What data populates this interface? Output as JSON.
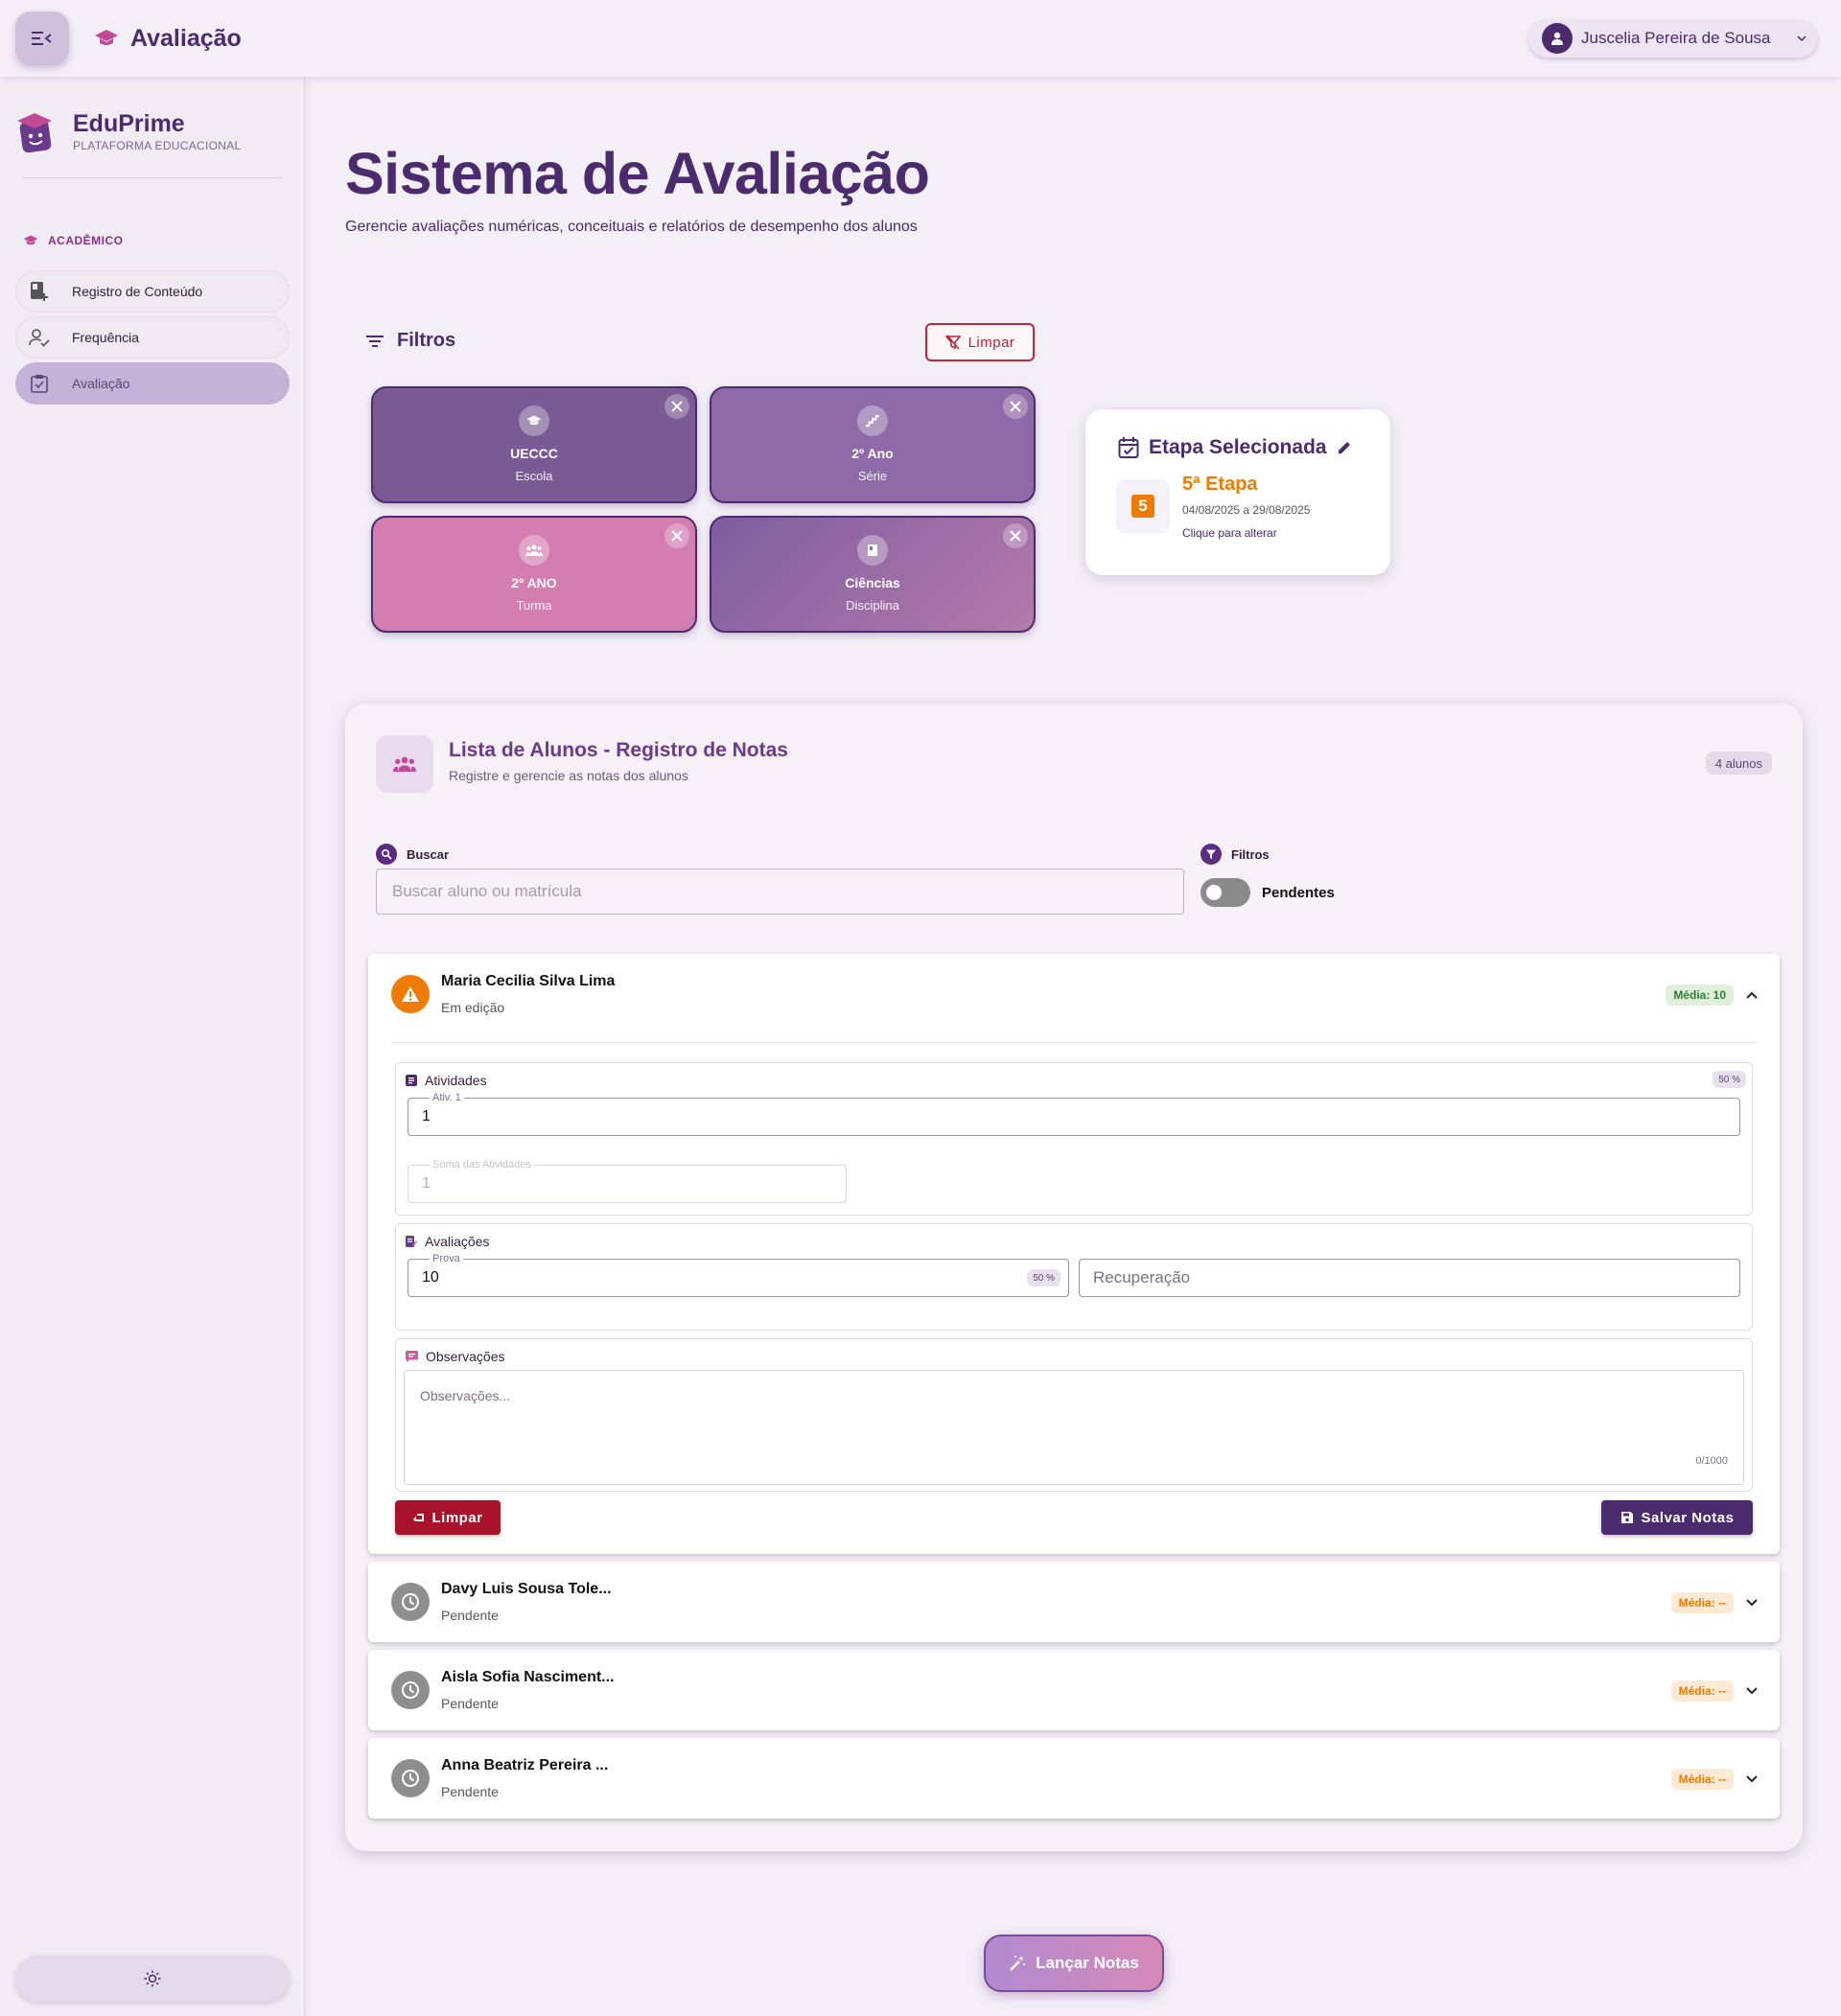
{
  "topbar": {
    "page_title": "Avaliação",
    "user_name": "Juscelia Pereira de Sousa"
  },
  "sidebar": {
    "brand_name": "EduPrime",
    "brand_tagline": "PLATAFORMA EDUCACIONAL",
    "section": "ACADÊMICO",
    "items": [
      {
        "label": "Registro de Conteúdo",
        "icon": "book-plus-icon",
        "active": false
      },
      {
        "label": "Frequência",
        "icon": "user-check-icon",
        "active": false
      },
      {
        "label": "Avaliação",
        "icon": "clipboard-check-icon",
        "active": true
      }
    ]
  },
  "hero": {
    "title": "Sistema de Avaliação",
    "subtitle": "Gerencie avaliações numéricas, conceituais e relatórios de desempenho dos alunos"
  },
  "filters": {
    "heading": "Filtros",
    "clear_label": "Limpar",
    "cards": [
      {
        "value": "UECCC",
        "label": "Escola",
        "icon": "graduation-cap-icon",
        "color": "#7a5a95"
      },
      {
        "value": "2º Ano",
        "label": "Série",
        "icon": "stairs-icon",
        "color": "#8f6aa8"
      },
      {
        "value": "2º ANO",
        "label": "Turma",
        "icon": "group-icon",
        "color": "#d47db1"
      },
      {
        "value": "Ciências",
        "label": "Disciplina",
        "icon": "book-icon",
        "color": "#9a6aa5"
      }
    ]
  },
  "stage": {
    "title": "Etapa Selecionada",
    "number": "5",
    "name": "5ª Etapa",
    "dates": "04/08/2025 a 29/08/2025",
    "change_label": "Clique para alterar"
  },
  "students_panel": {
    "title": "Lista de Alunos - Registro de Notas",
    "subtitle": "Registre e gerencie as notas dos alunos",
    "count": "4 alunos",
    "search_label": "Buscar",
    "search_placeholder": "Buscar aluno ou matrícula",
    "filters_label": "Filtros",
    "pending_toggle_label": "Pendentes"
  },
  "students": [
    {
      "name": "Maria Cecilia Silva Lima",
      "status": "Em edição",
      "average": "Média: 10",
      "expanded": true
    },
    {
      "name": "Davy Luis Sousa Tole...",
      "status": "Pendente",
      "average": "Média: --",
      "expanded": false
    },
    {
      "name": "Aisla Sofia Nasciment...",
      "status": "Pendente",
      "average": "Média: --",
      "expanded": false
    },
    {
      "name": "Anna Beatriz Pereira ...",
      "status": "Pendente",
      "average": "Média: --",
      "expanded": false
    }
  ],
  "grade_form": {
    "activities_title": "Atividades",
    "activities_weight": "50 %",
    "activity_label": "Ativ. 1",
    "activity_value": "1",
    "sum_label": "Soma das Atividades",
    "sum_value": "1",
    "assessments_title": "Avaliações",
    "exam_label": "Prova",
    "exam_value": "10",
    "exam_weight": "50 %",
    "recovery_placeholder": "Recuperação",
    "observations_title": "Observações",
    "observations_placeholder": "Observações...",
    "observations_counter": "0/1000",
    "clear_label": "Limpar",
    "save_label": "Salvar Notas"
  },
  "launch_button": "Lançar Notas"
}
